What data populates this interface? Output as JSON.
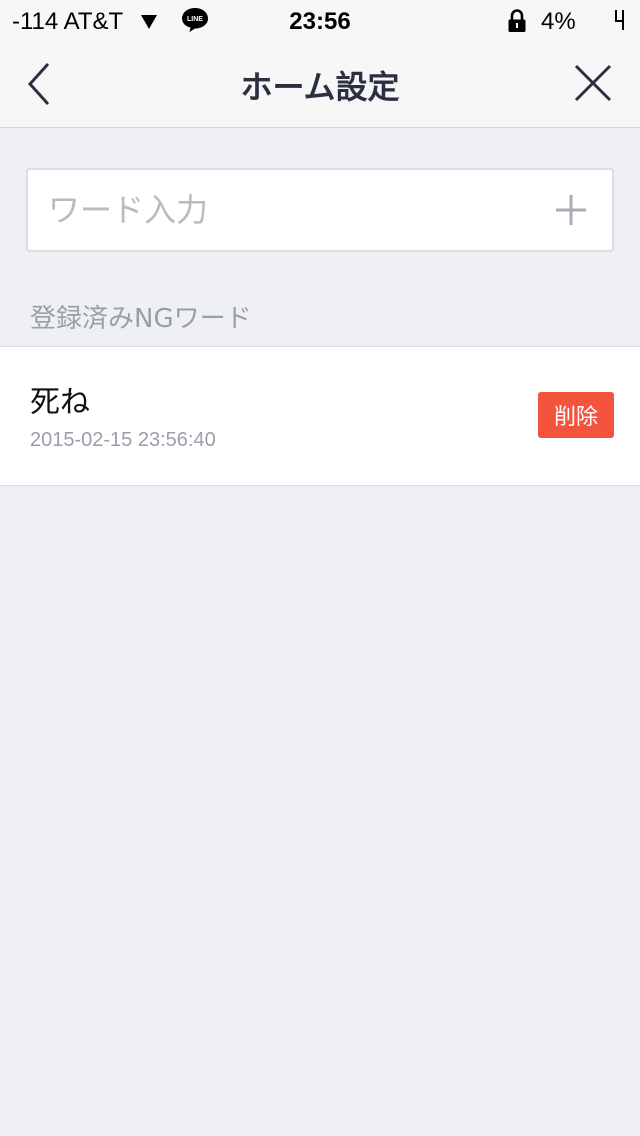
{
  "status_bar": {
    "carrier": "-114 AT&T",
    "time": "23:56",
    "battery": "4%",
    "line_icon_text": "LINE"
  },
  "nav": {
    "title": "ホーム設定"
  },
  "word_input": {
    "value": "",
    "placeholder": "ワード入力"
  },
  "section": {
    "label": "登録済みNGワード"
  },
  "ng_words": [
    {
      "word": "死ね",
      "date": "2015-02-15 23:56:40",
      "delete_label": "削除"
    }
  ],
  "colors": {
    "background": "#eff0f4",
    "delete": "#f4533e",
    "title": "#2a3040",
    "muted": "#9a9ea8"
  },
  "icons": [
    "wifi-icon",
    "line-icon",
    "lock-icon",
    "charge-icon",
    "back-chevron-icon",
    "close-icon",
    "plus-icon"
  ]
}
